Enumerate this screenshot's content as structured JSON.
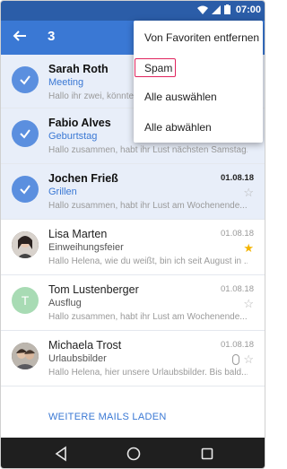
{
  "status": {
    "time": "07:00"
  },
  "appbar": {
    "count": "3"
  },
  "emails": [
    {
      "sender": "Sarah Roth",
      "subject": "Meeting",
      "preview": "Hallo ihr zwei, könntet ihr",
      "date": "",
      "selected": true
    },
    {
      "sender": "Fabio Alves",
      "subject": "Geburtstag",
      "preview": "Hallo zusammen, habt ihr Lust nächsten Samstag...",
      "date": "",
      "selected": true
    },
    {
      "sender": "Jochen Frieß",
      "subject": "Grillen",
      "preview": "Hallo zusammen, habt ihr Lust am Wochenende...",
      "date": "01.08.18",
      "selected": true,
      "starred": false
    },
    {
      "sender": "Lisa Marten",
      "subject": "Einweihungsfeier",
      "preview": "Hallo Helena, wie du weißt, bin ich seit August in ...",
      "date": "01.08.18",
      "starred": true
    },
    {
      "sender": "Tom Lustenberger",
      "subject": "Ausflug",
      "preview": "Hallo zusammen, habt ihr Lust am Wochenende...",
      "date": "01.08.18",
      "avatar_letter": "T",
      "starred": false
    },
    {
      "sender": "Michaela Trost",
      "subject": "Urlaubsbilder",
      "preview": "Hallo Helena, hier unsere Urlaubsbilder. Bis bald...",
      "date": "01.08.18",
      "starred": false,
      "attachment": true
    }
  ],
  "load_more": "WEITERE MAILS LADEN",
  "menu": {
    "items": [
      "Von Favoriten entfernen",
      "Spam",
      "Alle auswählen",
      "Alle abwählen"
    ]
  },
  "colors": {
    "primary": "#3a78d4",
    "status_bar": "#2b5da8",
    "highlight": "#e0245e",
    "star": "#f4b400"
  }
}
